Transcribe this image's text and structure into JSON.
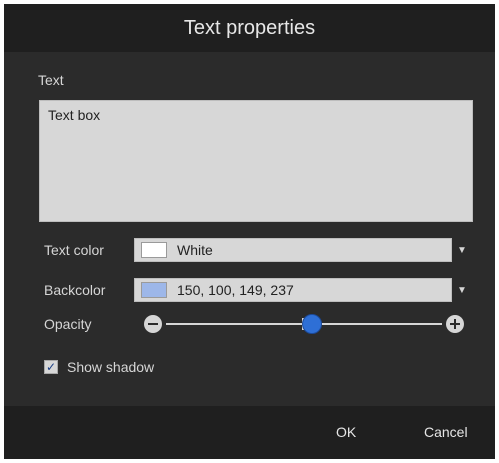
{
  "window": {
    "title": "Text properties"
  },
  "text_section": {
    "label": "Text",
    "value": "Text box"
  },
  "text_color": {
    "label": "Text color",
    "swatch_color": "#ffffff",
    "value": "White"
  },
  "backcolor": {
    "label": "Backcolor",
    "swatch_color": "#9db7e9",
    "value": "150, 100, 149, 237"
  },
  "opacity": {
    "label": "Opacity",
    "value_fraction": 0.53
  },
  "show_shadow": {
    "label": "Show shadow",
    "checked": true
  },
  "buttons": {
    "ok": "OK",
    "cancel": "Cancel"
  },
  "colors": {
    "dialog_bg": "#2b2b2b",
    "bar_bg": "#1f1f1f",
    "accent": "#2e6fd6"
  }
}
